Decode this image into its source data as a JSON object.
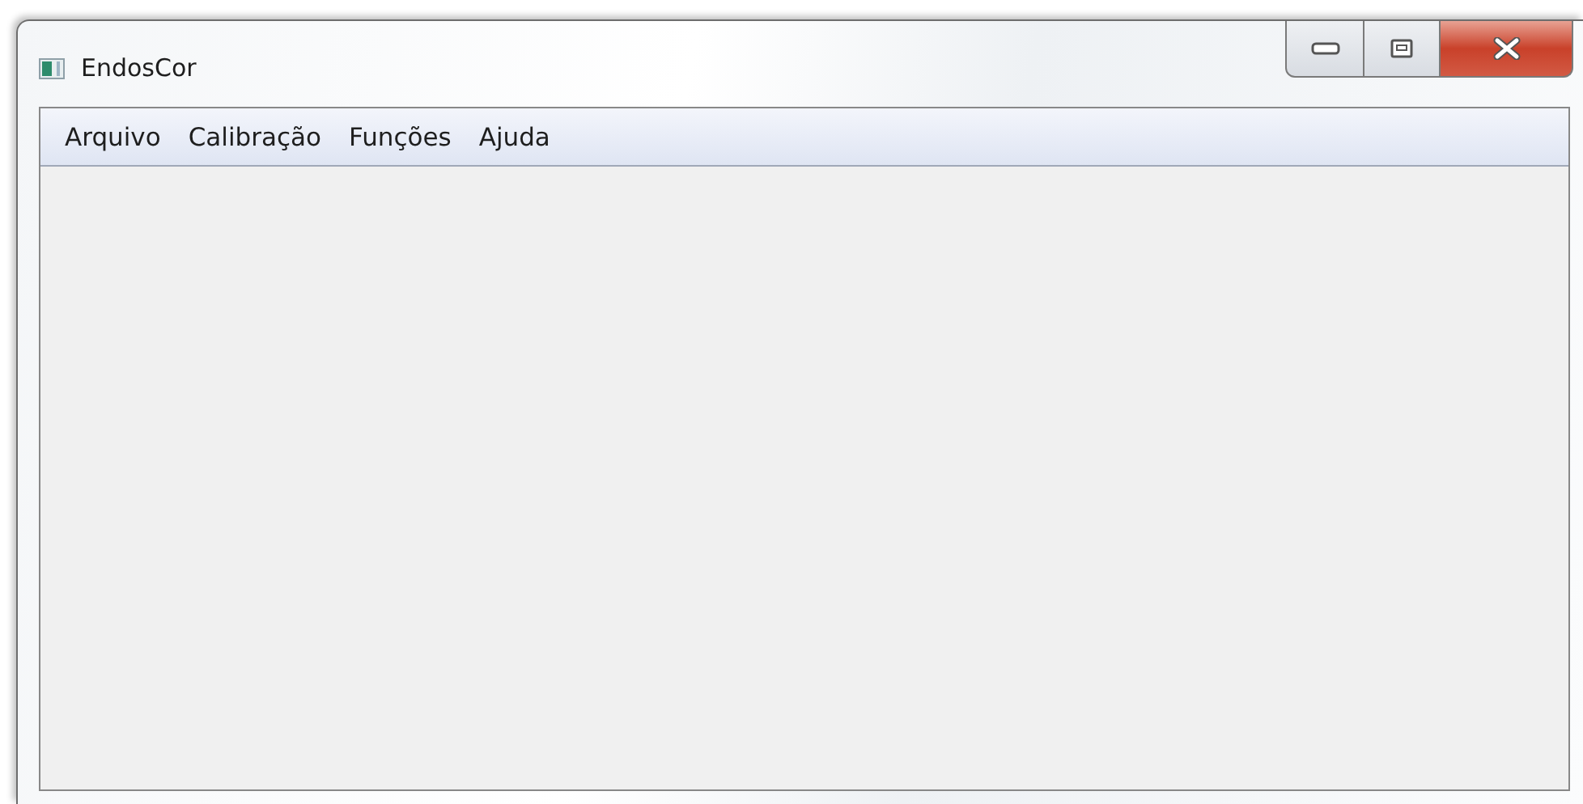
{
  "window": {
    "title": "EndosCor"
  },
  "menu": [
    {
      "label": "Arquivo"
    },
    {
      "label": "Calibração"
    },
    {
      "label": "Funções"
    },
    {
      "label": "Ajuda"
    }
  ]
}
